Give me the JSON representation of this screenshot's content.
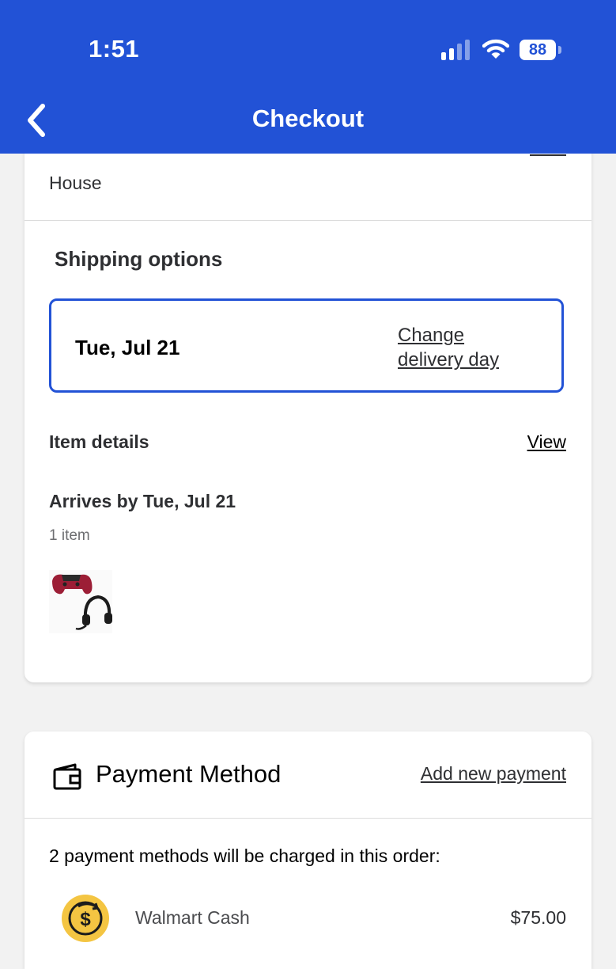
{
  "status_bar": {
    "time": "1:51",
    "battery": "88"
  },
  "header": {
    "title": "Checkout",
    "bg_color": "#2252d6"
  },
  "address": {
    "type": "House"
  },
  "shipping": {
    "title": "Shipping options",
    "selected_date": "Tue, Jul 21",
    "change_line1": "Change",
    "change_line2": "delivery day"
  },
  "items": {
    "title": "Item details",
    "view_label": "View",
    "arrives": "Arrives by Tue, Jul 21",
    "count": "1 item"
  },
  "payment": {
    "title": "Payment Method",
    "add_label": "Add new payment",
    "note": "2 payment methods will be charged in this order:",
    "methods": [
      {
        "label": "Walmart Cash",
        "amount": "$75.00"
      }
    ]
  }
}
